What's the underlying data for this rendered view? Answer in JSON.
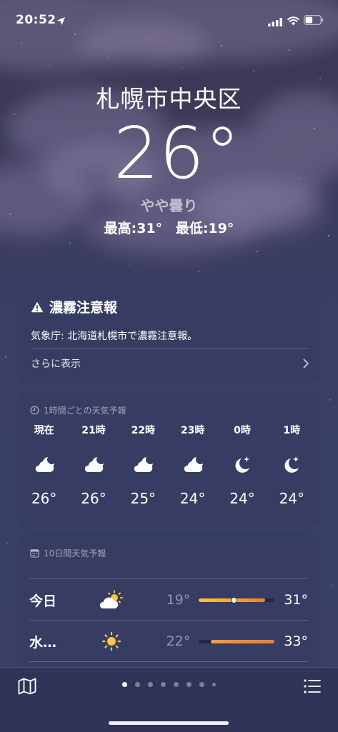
{
  "status_bar": {
    "time": "20:52",
    "icons": [
      "location-arrow-icon",
      "cellular-signal-icon",
      "wifi-icon",
      "battery-icon"
    ]
  },
  "header": {
    "city": "札幌市中央区",
    "temperature": "26°",
    "condition": "やや曇り",
    "high": "最高:31°",
    "low": "最低:19°"
  },
  "alert": {
    "title": "濃霧注意報",
    "body": "気象庁: 北海道札幌市で濃霧注意報。",
    "more_label": "さらに表示",
    "icons": [
      "warning-triangle-icon",
      "chevron-right-icon"
    ]
  },
  "hourly": {
    "title": "1時間ごとの天気予報",
    "items": [
      {
        "label": "現在",
        "icon": "partly-cloudy-night-icon",
        "temp": "26°"
      },
      {
        "label": "21時",
        "icon": "partly-cloudy-night-icon",
        "temp": "26°"
      },
      {
        "label": "22時",
        "icon": "partly-cloudy-night-icon",
        "temp": "25°"
      },
      {
        "label": "23時",
        "icon": "partly-cloudy-night-icon",
        "temp": "24°"
      },
      {
        "label": "0時",
        "icon": "clear-night-icon",
        "temp": "24°"
      },
      {
        "label": "1時",
        "icon": "clear-night-icon",
        "temp": "24°"
      }
    ]
  },
  "daily": {
    "title": "10日間天気予報",
    "items": [
      {
        "day": "今日",
        "icon": "partly-cloudy-day-icon",
        "low": "19°",
        "high": "31°",
        "range_start": 0.0,
        "range_end": 0.88,
        "current_marker": 0.46
      },
      {
        "day": "水…",
        "icon": "sunny-icon",
        "low": "22°",
        "high": "33°",
        "range_start": 0.16,
        "range_end": 1.0
      }
    ]
  },
  "toolbar": {
    "page_count": 8,
    "active_page": 0,
    "icons": [
      "map-icon",
      "list-icon"
    ]
  },
  "colors": {
    "background": "#3a4066",
    "card": "#373c62",
    "range_warm": "#f0a030",
    "range_hot": "#f07a3a",
    "range_yellow": "#f4c542"
  }
}
